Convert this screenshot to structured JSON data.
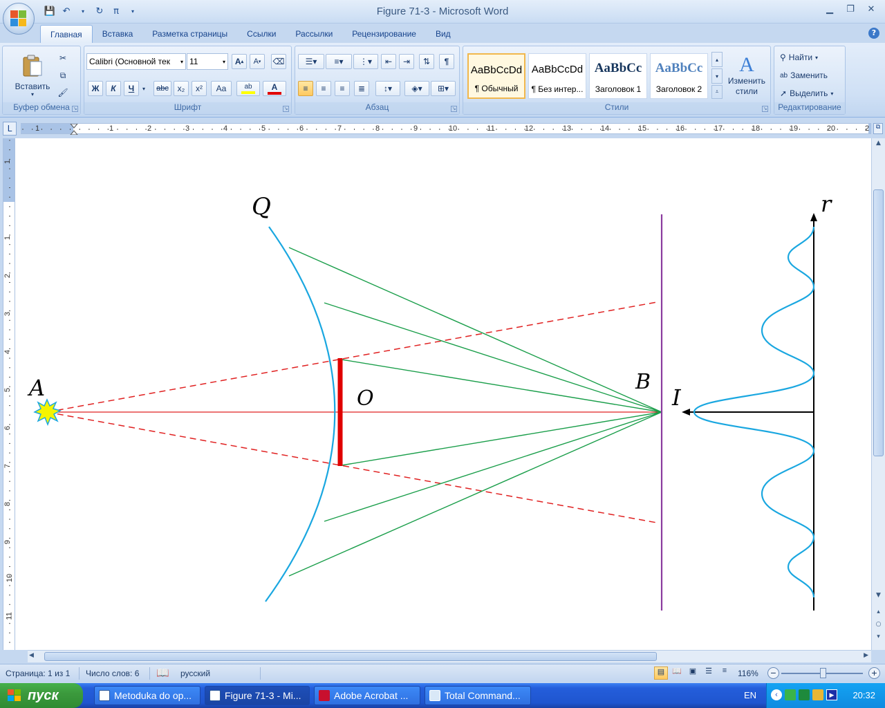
{
  "window": {
    "title": "Figure 71-3 - Microsoft Word",
    "qat": {
      "save": "💾",
      "undo": "↶",
      "redo": "↻",
      "pi": "π"
    }
  },
  "tabs": [
    {
      "label": "Главная",
      "active": true
    },
    {
      "label": "Вставка"
    },
    {
      "label": "Разметка страницы"
    },
    {
      "label": "Ссылки"
    },
    {
      "label": "Рассылки"
    },
    {
      "label": "Рецензирование"
    },
    {
      "label": "Вид"
    }
  ],
  "ribbon": {
    "clipboard": {
      "label": "Буфер обмена",
      "paste": "Вставить"
    },
    "font": {
      "label": "Шрифт",
      "font_name": "Calibri (Основной тек",
      "font_size": "11",
      "bold": "Ж",
      "italic": "К",
      "underline": "Ч",
      "strike": "abc",
      "subscript": "x₂",
      "superscript": "x²",
      "case": "Aa",
      "grow": "A",
      "shrink": "A",
      "highlight": "ab",
      "font_color": "A"
    },
    "paragraph": {
      "label": "Абзац",
      "pilcrow": "¶"
    },
    "styles": {
      "label": "Стили",
      "change_styles": "Изменить стили",
      "items": [
        {
          "sample": "AaBbCcDd",
          "name": "¶ Обычный"
        },
        {
          "sample": "AaBbCcDd",
          "name": "¶ Без интер..."
        },
        {
          "sample": "AaBbCc",
          "name": "Заголовок 1"
        },
        {
          "sample": "AaBbCc",
          "name": "Заголовок 2"
        }
      ]
    },
    "editing": {
      "label": "Редактирование",
      "find": "Найти",
      "replace": "Заменить",
      "select": "Выделить"
    }
  },
  "ruler": {
    "corner": "L",
    "h_labels": [
      "1",
      "1",
      "2",
      "3",
      "4",
      "5",
      "6",
      "7",
      "8",
      "9",
      "10",
      "11",
      "12",
      "13",
      "14",
      "15",
      "16",
      "17",
      "18",
      "19",
      "20",
      "2"
    ],
    "v_labels": [
      "1",
      "1",
      "2",
      "3",
      "4",
      "5",
      "6",
      "7",
      "8",
      "9",
      "10",
      "11"
    ]
  },
  "figure": {
    "labels": {
      "A": "A",
      "Q": "Q",
      "O": "O",
      "B": "B",
      "I": "I",
      "r": "r"
    },
    "colors": {
      "lens": "#1aa7e0",
      "rays": "#1a9e4a",
      "axis": "#e02020",
      "screen": "#8a3a9e",
      "obstacle": "#e00000",
      "source": "#f4f400",
      "intensity": "#1aa7e0"
    }
  },
  "status": {
    "page": "Страница: 1 из 1",
    "words": "Число слов: 6",
    "language": "русский",
    "zoom": "116%"
  },
  "taskbar": {
    "start": "пуск",
    "tasks": [
      {
        "label": "Metoduka do op...",
        "active": false
      },
      {
        "label": "Figure 71-3 - Mi...",
        "active": true
      },
      {
        "label": "Adobe Acrobat ...",
        "active": false
      },
      {
        "label": "Total Command...",
        "active": false
      }
    ],
    "lang": "EN",
    "clock": "20:32"
  }
}
